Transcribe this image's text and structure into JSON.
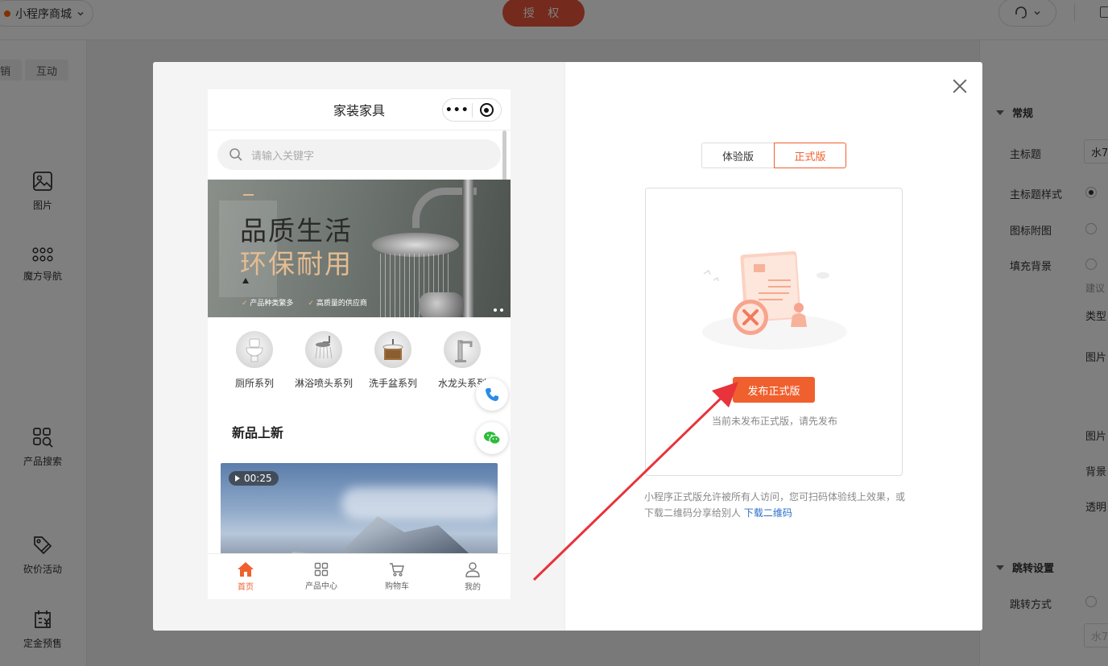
{
  "topbar": {
    "app_name": "小程序商城",
    "auth_label": "授 权"
  },
  "left_panel": {
    "tabs": [
      "销",
      "互动"
    ],
    "items": [
      {
        "label": "图片",
        "icon": "image-icon"
      },
      {
        "label": "魔方导航",
        "icon": "grid-dots-icon"
      },
      {
        "label": "产品搜索",
        "icon": "grid-search-icon"
      },
      {
        "label": "砍价活动",
        "icon": "tag-edit-icon"
      },
      {
        "label": "定金预售",
        "icon": "deposit-calendar-icon"
      }
    ]
  },
  "right_panel": {
    "section_general": "常规",
    "rows": [
      {
        "label": "主标题",
        "value": "水7"
      },
      {
        "label": "主标题样式"
      },
      {
        "label": "图标附图"
      },
      {
        "label": "填充背景"
      }
    ],
    "hint": "建议",
    "labels_more": [
      "类型",
      "图片",
      "图片",
      "背景",
      "透明"
    ],
    "section_jump": "跳转设置",
    "jump_label": "跳转方式",
    "jump_input_value": "水7"
  },
  "modal": {
    "phone": {
      "title": "家装家具",
      "search_placeholder": "请输入关键字",
      "banner": {
        "line1": "品质生活",
        "line2": "环保耐用",
        "tags": [
          "产品种类繁多",
          "高质量的供应商"
        ]
      },
      "categories": [
        "厕所系列",
        "淋浴喷头系列",
        "洗手盆系列",
        "水龙头系列"
      ],
      "section_title": "新品上新",
      "video_duration": "00:25",
      "tabbar": [
        {
          "label": "首页",
          "icon": "home-icon",
          "active": true
        },
        {
          "label": "产品中心",
          "icon": "grid-icon",
          "active": false
        },
        {
          "label": "购物车",
          "icon": "cart-icon",
          "active": false
        },
        {
          "label": "我的",
          "icon": "user-icon",
          "active": false
        }
      ]
    },
    "segment": {
      "trial": "体验版",
      "release": "正式版"
    },
    "publish_button": "发布正式版",
    "card_tip": "当前未发布正式版，请先发布",
    "note_text": "小程序正式版允许被所有人访问，您可扫码体验线上效果，或下载二维码分享给别人",
    "note_link": "下载二维码"
  },
  "colors": {
    "accent": "#f0602e",
    "auth_button": "#e8553a",
    "link": "#2a6fc9",
    "arrow": "#e8333a"
  }
}
